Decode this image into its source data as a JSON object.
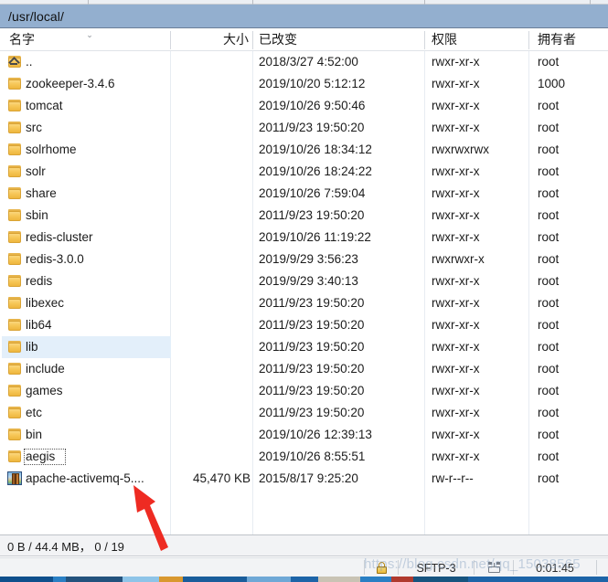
{
  "window": {
    "path_bar_value": "/usr/local/"
  },
  "columns": {
    "name": "名字",
    "size": "大小",
    "modified": "已改变",
    "permissions": "权限",
    "owner": "拥有者",
    "sort_indicator": "⌄"
  },
  "files": [
    {
      "name": "..",
      "size": "",
      "modified": "2018/3/27 4:52:00",
      "permissions": "rwxr-xr-x",
      "owner": "root",
      "icon": "folder-up-icon",
      "selected": false,
      "focused": false
    },
    {
      "name": "zookeeper-3.4.6",
      "size": "",
      "modified": "2019/10/20 5:12:12",
      "permissions": "rwxr-xr-x",
      "owner": "1000",
      "icon": "folder-icon",
      "selected": false,
      "focused": false
    },
    {
      "name": "tomcat",
      "size": "",
      "modified": "2019/10/26 9:50:46",
      "permissions": "rwxr-xr-x",
      "owner": "root",
      "icon": "folder-icon",
      "selected": false,
      "focused": false
    },
    {
      "name": "src",
      "size": "",
      "modified": "2011/9/23 19:50:20",
      "permissions": "rwxr-xr-x",
      "owner": "root",
      "icon": "folder-icon",
      "selected": false,
      "focused": false
    },
    {
      "name": "solrhome",
      "size": "",
      "modified": "2019/10/26 18:34:12",
      "permissions": "rwxrwxrwx",
      "owner": "root",
      "icon": "folder-icon",
      "selected": false,
      "focused": false
    },
    {
      "name": "solr",
      "size": "",
      "modified": "2019/10/26 18:24:22",
      "permissions": "rwxr-xr-x",
      "owner": "root",
      "icon": "folder-icon",
      "selected": false,
      "focused": false
    },
    {
      "name": "share",
      "size": "",
      "modified": "2019/10/26 7:59:04",
      "permissions": "rwxr-xr-x",
      "owner": "root",
      "icon": "folder-icon",
      "selected": false,
      "focused": false
    },
    {
      "name": "sbin",
      "size": "",
      "modified": "2011/9/23 19:50:20",
      "permissions": "rwxr-xr-x",
      "owner": "root",
      "icon": "folder-icon",
      "selected": false,
      "focused": false
    },
    {
      "name": "redis-cluster",
      "size": "",
      "modified": "2019/10/26 11:19:22",
      "permissions": "rwxr-xr-x",
      "owner": "root",
      "icon": "folder-icon",
      "selected": false,
      "focused": false
    },
    {
      "name": "redis-3.0.0",
      "size": "",
      "modified": "2019/9/29 3:56:23",
      "permissions": "rwxrwxr-x",
      "owner": "root",
      "icon": "folder-icon",
      "selected": false,
      "focused": false
    },
    {
      "name": "redis",
      "size": "",
      "modified": "2019/9/29 3:40:13",
      "permissions": "rwxr-xr-x",
      "owner": "root",
      "icon": "folder-icon",
      "selected": false,
      "focused": false
    },
    {
      "name": "libexec",
      "size": "",
      "modified": "2011/9/23 19:50:20",
      "permissions": "rwxr-xr-x",
      "owner": "root",
      "icon": "folder-icon",
      "selected": false,
      "focused": false
    },
    {
      "name": "lib64",
      "size": "",
      "modified": "2011/9/23 19:50:20",
      "permissions": "rwxr-xr-x",
      "owner": "root",
      "icon": "folder-icon",
      "selected": false,
      "focused": false
    },
    {
      "name": "lib",
      "size": "",
      "modified": "2011/9/23 19:50:20",
      "permissions": "rwxr-xr-x",
      "owner": "root",
      "icon": "folder-icon",
      "selected": true,
      "focused": false
    },
    {
      "name": "include",
      "size": "",
      "modified": "2011/9/23 19:50:20",
      "permissions": "rwxr-xr-x",
      "owner": "root",
      "icon": "folder-icon",
      "selected": false,
      "focused": false
    },
    {
      "name": "games",
      "size": "",
      "modified": "2011/9/23 19:50:20",
      "permissions": "rwxr-xr-x",
      "owner": "root",
      "icon": "folder-icon",
      "selected": false,
      "focused": false
    },
    {
      "name": "etc",
      "size": "",
      "modified": "2011/9/23 19:50:20",
      "permissions": "rwxr-xr-x",
      "owner": "root",
      "icon": "folder-icon",
      "selected": false,
      "focused": false
    },
    {
      "name": "bin",
      "size": "",
      "modified": "2019/10/26 12:39:13",
      "permissions": "rwxr-xr-x",
      "owner": "root",
      "icon": "folder-icon",
      "selected": false,
      "focused": false
    },
    {
      "name": "aegis",
      "size": "",
      "modified": "2019/10/26 8:55:51",
      "permissions": "rwxr-xr-x",
      "owner": "root",
      "icon": "folder-icon",
      "selected": false,
      "focused": true
    },
    {
      "name": "apache-activemq-5....",
      "size": "45,470 KB",
      "modified": "2015/8/17 9:25:20",
      "permissions": "rw-r--r--",
      "owner": "root",
      "icon": "archive-icon",
      "selected": false,
      "focused": false
    }
  ],
  "status": {
    "transfer_summary": "0 B / 44.4 MB，  0 / 19"
  },
  "app_status": {
    "session_label": "SFTP-3",
    "elapsed_time": "0:01:45",
    "lock_icon": "lock-icon",
    "network_icon": "network-icon"
  },
  "watermark": {
    "text": "https://blog.csdn.net/qq_15038565"
  },
  "colors": {
    "path_bar": "#93afcf",
    "selection": "#e3effa",
    "folder": "#f2c45a",
    "arrow_annotation": "#ee2b22"
  }
}
